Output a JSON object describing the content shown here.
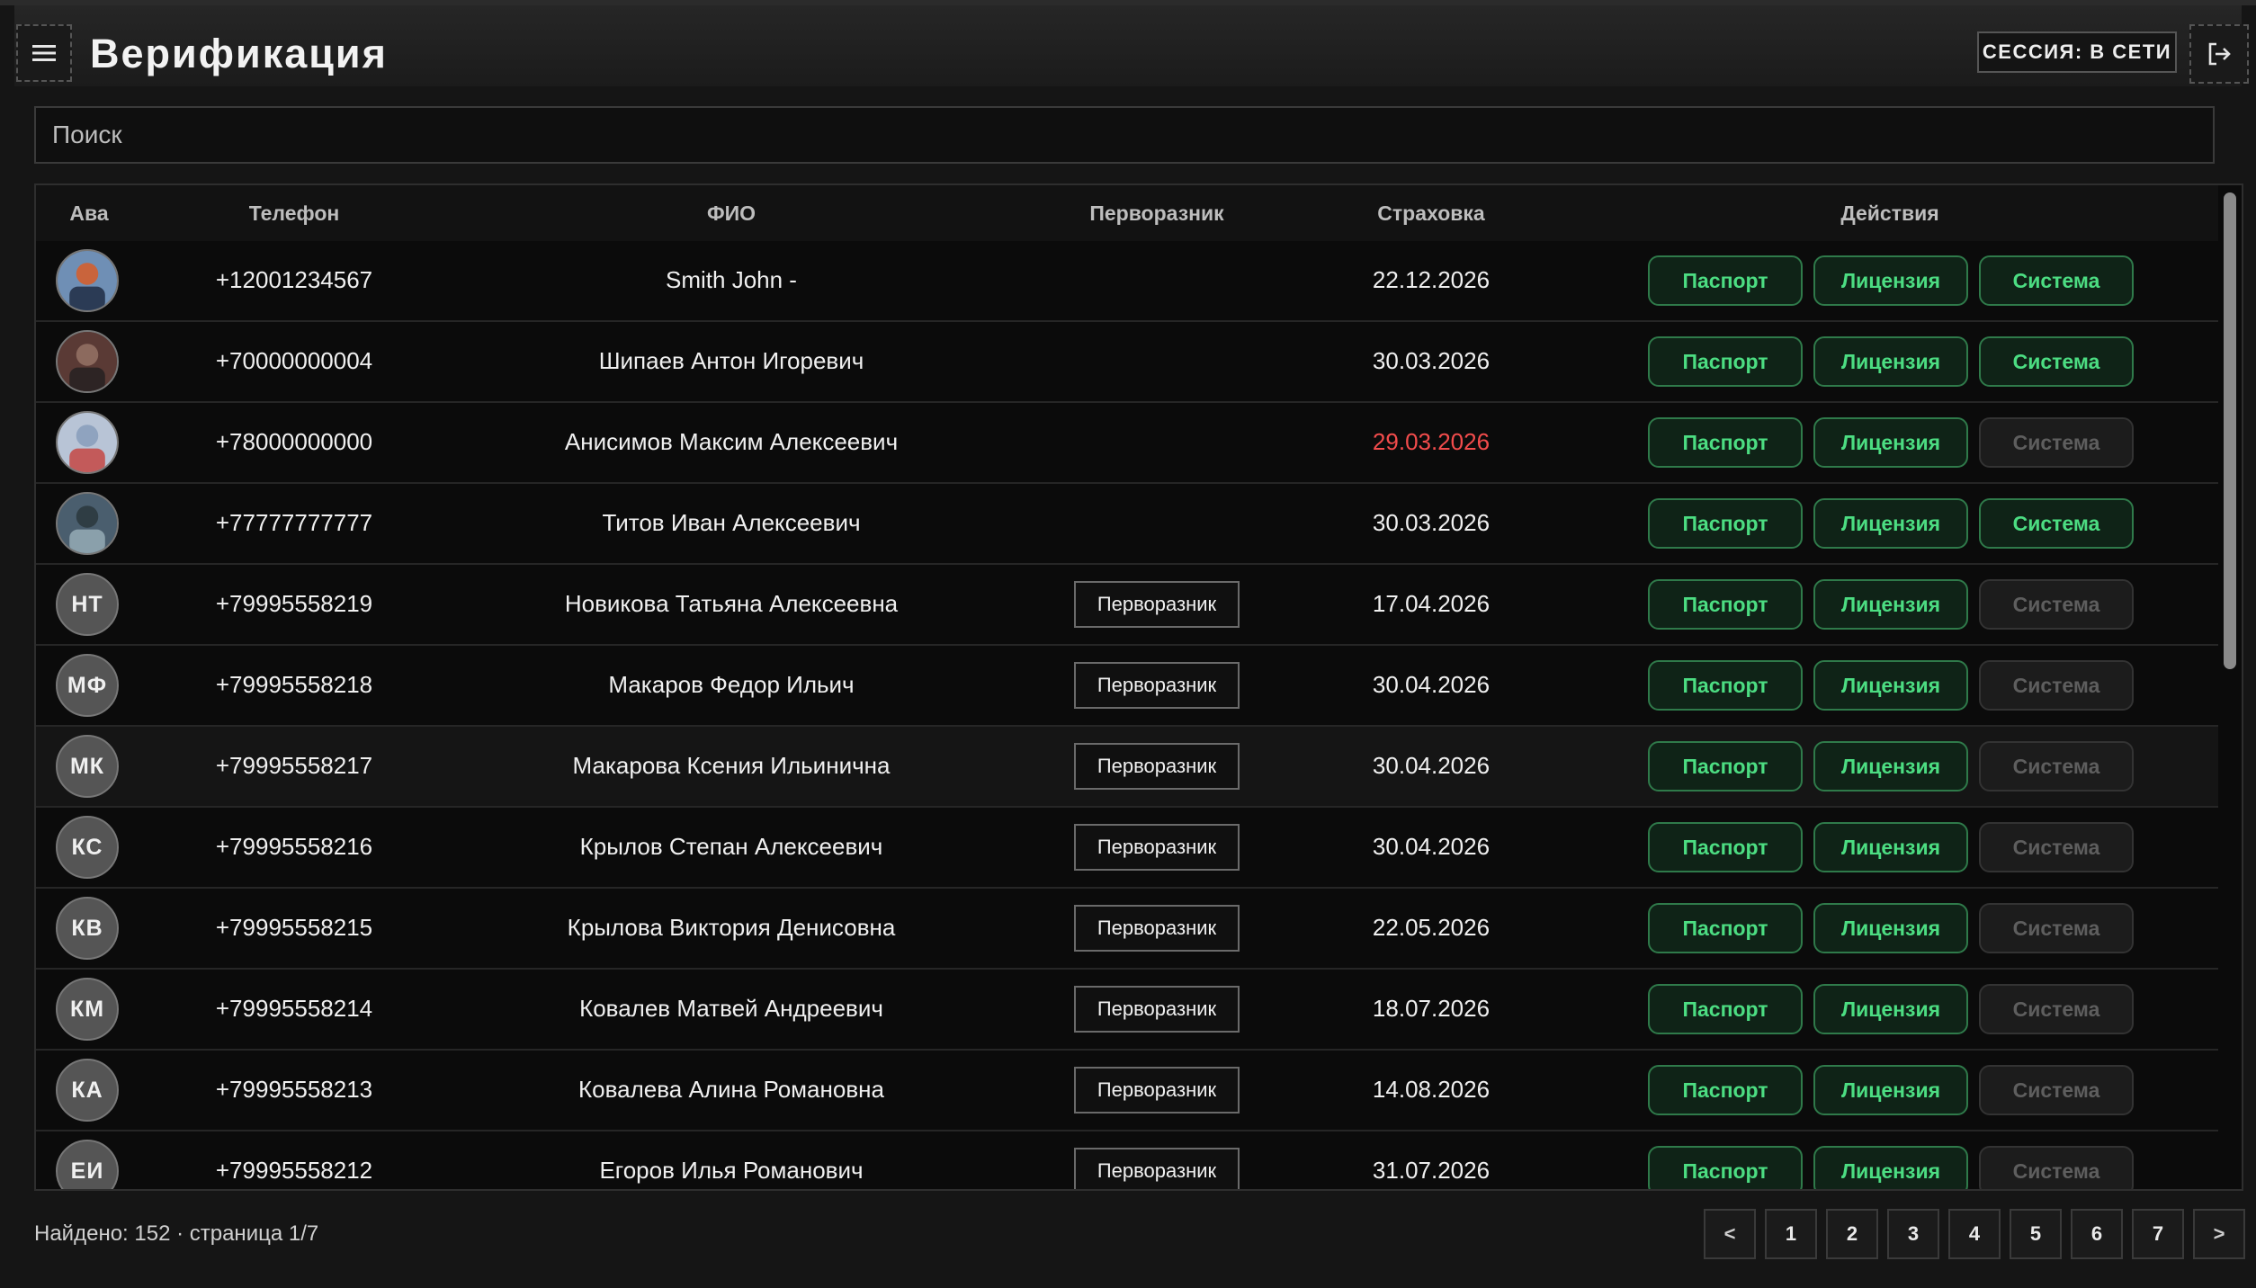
{
  "header": {
    "title": "Верификация",
    "session_label": "СЕССИЯ: В СЕТИ"
  },
  "search": {
    "placeholder": "Поиск",
    "value": ""
  },
  "table": {
    "columns": [
      "Ава",
      "Телефон",
      "ФИО",
      "Перворазник",
      "Страховка",
      "Действия"
    ],
    "action_labels": {
      "passport": "Паспорт",
      "license": "Лицензия",
      "system": "Система"
    },
    "rows": [
      {
        "avatar": "",
        "avatar_photo": "photo-1",
        "phone": "+12001234567",
        "name": "Smith John -",
        "first_timer": "",
        "insurance": "22.12.2026",
        "insurance_expired": false,
        "system_enabled": true
      },
      {
        "avatar": "",
        "avatar_photo": "photo-2",
        "phone": "+70000000004",
        "name": "Шипаев Антон Игоревич",
        "first_timer": "",
        "insurance": "30.03.2026",
        "insurance_expired": false,
        "system_enabled": true
      },
      {
        "avatar": "",
        "avatar_photo": "photo-3",
        "phone": "+78000000000",
        "name": "Анисимов Максим Алексеевич",
        "first_timer": "",
        "insurance": "29.03.2026",
        "insurance_expired": true,
        "system_enabled": false
      },
      {
        "avatar": "",
        "avatar_photo": "photo-4",
        "phone": "+77777777777",
        "name": "Титов Иван Алексеевич",
        "first_timer": "",
        "insurance": "30.03.2026",
        "insurance_expired": false,
        "system_enabled": true
      },
      {
        "avatar": "НТ",
        "avatar_photo": "",
        "phone": "+79995558219",
        "name": "Новикова Татьяна Алексеевна",
        "first_timer": "Перворазник",
        "insurance": "17.04.2026",
        "insurance_expired": false,
        "system_enabled": false
      },
      {
        "avatar": "МФ",
        "avatar_photo": "",
        "phone": "+79995558218",
        "name": "Макаров Федор Ильич",
        "first_timer": "Перворазник",
        "insurance": "30.04.2026",
        "insurance_expired": false,
        "system_enabled": false
      },
      {
        "avatar": "МК",
        "avatar_photo": "",
        "phone": "+79995558217",
        "name": "Макарова Ксения Ильинична",
        "first_timer": "Перворазник",
        "insurance": "30.04.2026",
        "insurance_expired": false,
        "system_enabled": false,
        "highlighted": true
      },
      {
        "avatar": "КС",
        "avatar_photo": "",
        "phone": "+79995558216",
        "name": "Крылов Степан Алексеевич",
        "first_timer": "Перворазник",
        "insurance": "30.04.2026",
        "insurance_expired": false,
        "system_enabled": false
      },
      {
        "avatar": "КВ",
        "avatar_photo": "",
        "phone": "+79995558215",
        "name": "Крылова Виктория Денисовна",
        "first_timer": "Перворазник",
        "insurance": "22.05.2026",
        "insurance_expired": false,
        "system_enabled": false
      },
      {
        "avatar": "КМ",
        "avatar_photo": "",
        "phone": "+79995558214",
        "name": "Ковалев Матвей Андреевич",
        "first_timer": "Перворазник",
        "insurance": "18.07.2026",
        "insurance_expired": false,
        "system_enabled": false
      },
      {
        "avatar": "КА",
        "avatar_photo": "",
        "phone": "+79995558213",
        "name": "Ковалева Алина Романовна",
        "first_timer": "Перворазник",
        "insurance": "14.08.2026",
        "insurance_expired": false,
        "system_enabled": false
      },
      {
        "avatar": "ЕИ",
        "avatar_photo": "",
        "phone": "+79995558212",
        "name": "Егоров Илья Романович",
        "first_timer": "Перворазник",
        "insurance": "31.07.2026",
        "insurance_expired": false,
        "system_enabled": false
      }
    ]
  },
  "footer": {
    "summary": "Найдено: 152 · страница 1/7",
    "pages": [
      "<",
      "1",
      "2",
      "3",
      "4",
      "5",
      "6",
      "7",
      ">"
    ]
  },
  "icons": {
    "menu": "menu-icon",
    "logout": "logout-icon"
  },
  "colors": {
    "accent_green": "#4cdd82",
    "danger_red": "#f24c4c",
    "background": "#151515"
  }
}
